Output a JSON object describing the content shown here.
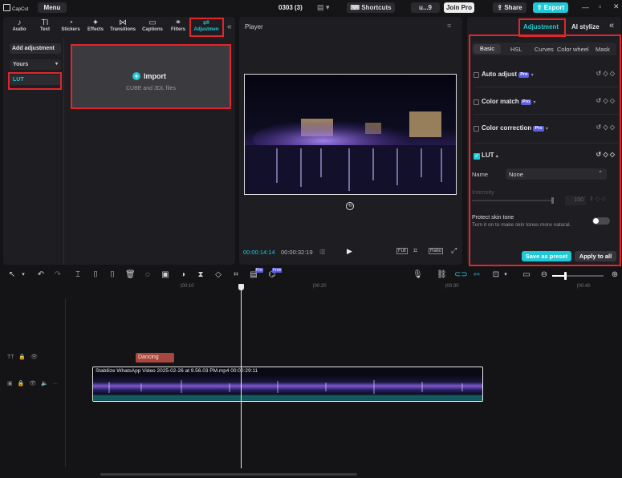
{
  "titlebar": {
    "app_name": "CapCut",
    "menu_label": "Menu",
    "project_name": "0303 (3)",
    "shortcuts_label": "Shortcuts",
    "user_label": "u...9",
    "join_pro_label": "Join Pro",
    "share_label": "Share",
    "export_label": "Export"
  },
  "toolbar": {
    "tools": [
      {
        "label": "Audio",
        "icon": "audio-icon",
        "glyph": "♪"
      },
      {
        "label": "Text",
        "icon": "text-icon",
        "glyph": "TI"
      },
      {
        "label": "Stickers",
        "icon": "sticker-icon",
        "glyph": "◔"
      },
      {
        "label": "Effects",
        "icon": "effects-icon",
        "glyph": "✦"
      },
      {
        "label": "Transitions",
        "icon": "transitions-icon",
        "glyph": "⋈"
      },
      {
        "label": "Captions",
        "icon": "captions-icon",
        "glyph": "▭"
      },
      {
        "label": "Filters",
        "icon": "filters-icon",
        "glyph": "⚭"
      },
      {
        "label": "Adjustmen",
        "icon": "adjustment-icon",
        "glyph": "⇌"
      }
    ]
  },
  "left_sidebar": {
    "add_adjustment": "Add adjustment",
    "yours": "Yours",
    "lut": "LUT"
  },
  "import_box": {
    "label": "Import",
    "sub": "CUBE and 3DL files"
  },
  "player": {
    "title": "Player",
    "current_time": "00:00:14:14",
    "total_time": "00:00:32:19",
    "full_label": "Full",
    "ratio_label": "Ratio"
  },
  "right_panel": {
    "tab_adjustment": "Adjustment",
    "tab_ai_stylize": "AI stylize",
    "subtabs": [
      "Basic",
      "HSL",
      "Curves",
      "Color wheel",
      "Mask"
    ],
    "rows": [
      {
        "label": "Auto adjust",
        "pro": "Pro"
      },
      {
        "label": "Color match",
        "pro": "Pro"
      },
      {
        "label": "Color correction",
        "pro": "Pro"
      }
    ],
    "lut_label": "LUT",
    "name_label": "Name",
    "name_value": "None",
    "intensity_label": "Intensity",
    "intensity_value": "100",
    "protect_title": "Protect skin tone",
    "protect_desc": "Turn it on to make skin tones more natural.",
    "save_preset": "Save as preset",
    "apply_all": "Apply to all"
  },
  "timeline": {
    "ruler": [
      "|00:10",
      "|00:20",
      "|00:30",
      "|00:40"
    ],
    "text_clip": "Dancing",
    "video_clip": "Stabilize  WhatsApp Video 2025-02-26 at 9.56.03 PM.mp4   00:00:29:11",
    "badge_pro": "Pro",
    "badge_free": "Free"
  },
  "colors": {
    "accent": "#1fc9d6",
    "pro_purple": "#5d5fe0",
    "highlight_red": "#e0262c",
    "text_clip": "#a8473d"
  }
}
